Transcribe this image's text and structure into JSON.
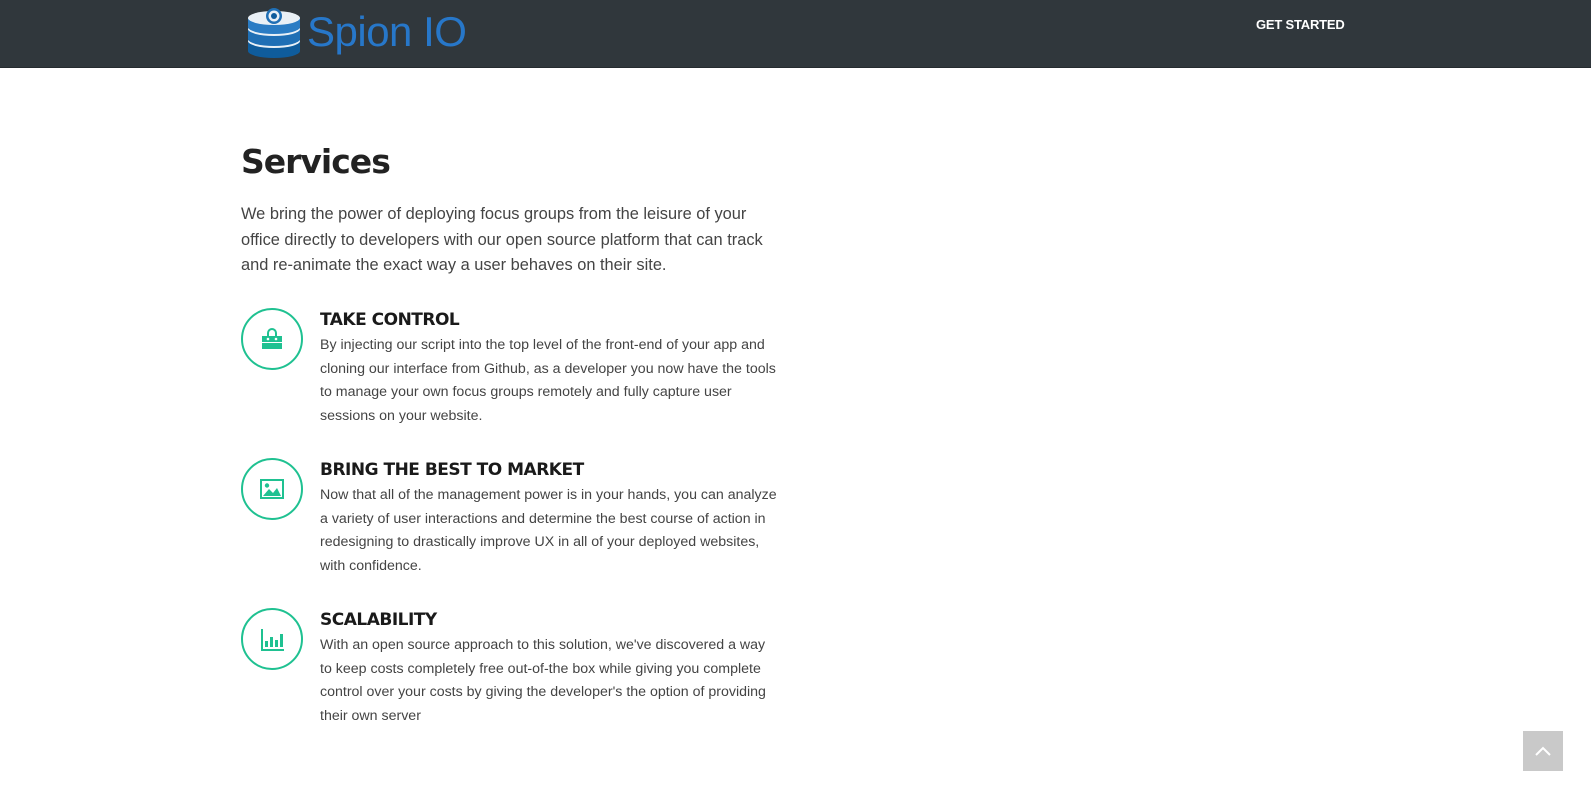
{
  "header": {
    "brand_name": "Spion IO",
    "brand_color": "#2777c9",
    "logo_icon": "database-eye-icon",
    "nav_cta": "GET STARTED"
  },
  "services": {
    "title": "Services",
    "intro": "We bring the power of deploying focus groups from the leisure of your office directly to developers with our open source platform that can track and re-animate the exact way a user behaves on their site.",
    "accent_color": "#1fc191",
    "features": [
      {
        "icon": "shopping-bag-icon",
        "title": "TAKE CONTROL",
        "text": "By injecting our script into the top level of the front-end of your app and cloning our interface from Github, as a developer you now have the tools to manage your own focus groups remotely and fully capture user sessions on your website."
      },
      {
        "icon": "image-icon",
        "title": "BRING THE BEST TO MARKET",
        "text": "Now that all of the management power is in your hands, you can analyze a variety of user interactions and determine the best course of action in redesigning to drastically improve UX in all of your deployed websites, with confidence."
      },
      {
        "icon": "bar-chart-icon",
        "title": "SCALABILITY",
        "text": "With an open source approach to this solution, we've discovered a way to keep costs completely free out-of-the box while giving you complete control over your costs by giving the developer's the option of providing their own server"
      }
    ]
  },
  "scroll_top": {
    "icon": "chevron-up-icon"
  }
}
